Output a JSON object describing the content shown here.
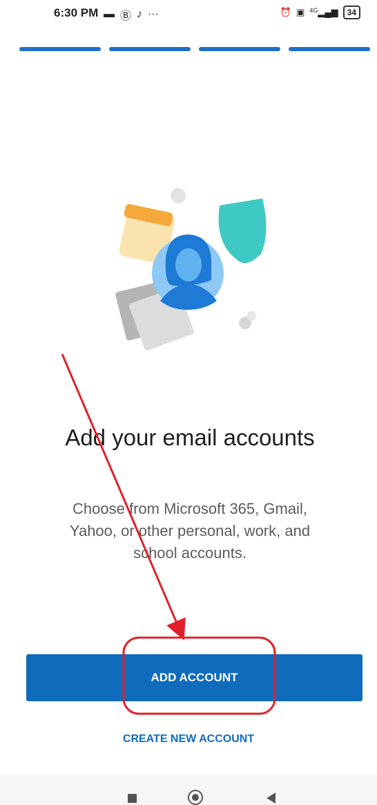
{
  "status_bar": {
    "time": "6:30 PM",
    "battery": "34",
    "network": "4G",
    "left_icons": [
      "message-icon",
      "b-circle-icon",
      "tiktok-icon",
      "more-dots-icon"
    ],
    "right_icons": [
      "alarm-icon",
      "volte-icon",
      "signal-icon",
      "battery-icon"
    ]
  },
  "progress": {
    "segments": 4,
    "accent": "#1e6fc9"
  },
  "onboarding": {
    "title": "Add your email accounts",
    "subtitle": "Choose from Microsoft 365, Gmail, Yahoo, or other personal, work, and school accounts."
  },
  "actions": {
    "add_account": "ADD ACCOUNT",
    "create_account": "CREATE NEW ACCOUNT",
    "primary_color": "#0f6cbd"
  },
  "nav": {
    "icons": [
      "recents-icon",
      "home-icon",
      "back-icon"
    ]
  },
  "annotation": {
    "color": "#e0202a"
  }
}
